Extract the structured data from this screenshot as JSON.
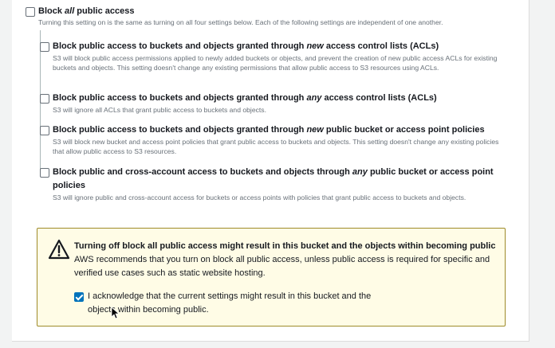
{
  "block_all": {
    "title_prefix": "Block ",
    "title_em": "all",
    "title_suffix": " public access",
    "description": "Turning this setting on is the same as turning on all four settings below. Each of the following settings are independent of one another.",
    "checked": false
  },
  "settings": [
    {
      "title_prefix": "Block public access to buckets and objects granted through ",
      "title_em": "new",
      "title_suffix": " access control lists (ACLs)",
      "description": "S3 will block public access permissions applied to newly added buckets or objects, and prevent the creation of new public access ACLs for existing buckets and objects. This setting doesn't change any existing permissions that allow public access to S3 resources using ACLs.",
      "checked": false
    },
    {
      "title_prefix": "Block public access to buckets and objects granted through ",
      "title_em": "any",
      "title_suffix": " access control lists (ACLs)",
      "description": "S3 will ignore all ACLs that grant public access to buckets and objects.",
      "checked": false
    },
    {
      "title_prefix": "Block public access to buckets and objects granted through ",
      "title_em": "new",
      "title_suffix": " public bucket or access point policies",
      "description": "S3 will block new bucket and access point policies that grant public access to buckets and objects. This setting doesn't change any existing policies that allow public access to S3 resources.",
      "checked": false
    },
    {
      "title_prefix": "Block public and cross-account access to buckets and objects through ",
      "title_em": "any",
      "title_suffix": " public bucket or access point policies",
      "description": "S3 will ignore public and cross-account access for buckets or access points with policies that grant public access to buckets and objects.",
      "checked": false
    }
  ],
  "warning": {
    "icon": "warning-triangle-icon",
    "title": "Turning off block all public access might result in this bucket and the objects within becoming public",
    "body": "AWS recommends that you turn on block all public access, unless public access is required for specific and verified use cases such as static website hosting.",
    "acknowledge_label": "I acknowledge that the current settings might result in this bucket and the objects within becoming public.",
    "acknowledge_checked": true
  },
  "colors": {
    "accent": "#0073bb",
    "warning_border": "#9e8b2a",
    "warning_background": "#fffce6"
  }
}
